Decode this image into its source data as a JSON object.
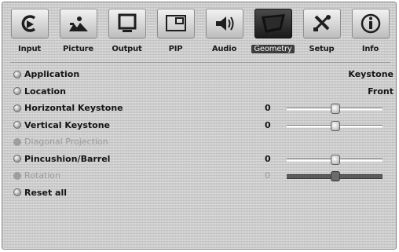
{
  "tabs": [
    {
      "label": "Input",
      "icon": "input-icon",
      "active": false
    },
    {
      "label": "Picture",
      "icon": "picture-icon",
      "active": false
    },
    {
      "label": "Output",
      "icon": "output-icon",
      "active": false
    },
    {
      "label": "PIP",
      "icon": "pip-icon",
      "active": false
    },
    {
      "label": "Audio",
      "icon": "audio-icon",
      "active": false
    },
    {
      "label": "Geometry",
      "icon": "geometry-icon",
      "active": true
    },
    {
      "label": "Setup",
      "icon": "setup-icon",
      "active": false
    },
    {
      "label": "Info",
      "icon": "info-icon",
      "active": false
    }
  ],
  "rows": [
    {
      "label": "Application",
      "value": "Keystone",
      "enabled": true
    },
    {
      "label": "Location",
      "value": "Front",
      "enabled": true
    },
    {
      "label": "Horizontal Keystone",
      "number": "0",
      "slider_fraction": 0.5,
      "enabled": true
    },
    {
      "label": "Vertical Keystone",
      "number": "0",
      "slider_fraction": 0.5,
      "enabled": true
    },
    {
      "label": "Diagonal Projection",
      "enabled": false
    },
    {
      "label": "Pincushion/Barrel",
      "number": "0",
      "slider_fraction": 0.5,
      "enabled": true
    },
    {
      "label": "Rotation",
      "number": "0",
      "slider_fraction": 0.5,
      "enabled": false
    },
    {
      "label": "Reset all",
      "enabled": true
    }
  ]
}
